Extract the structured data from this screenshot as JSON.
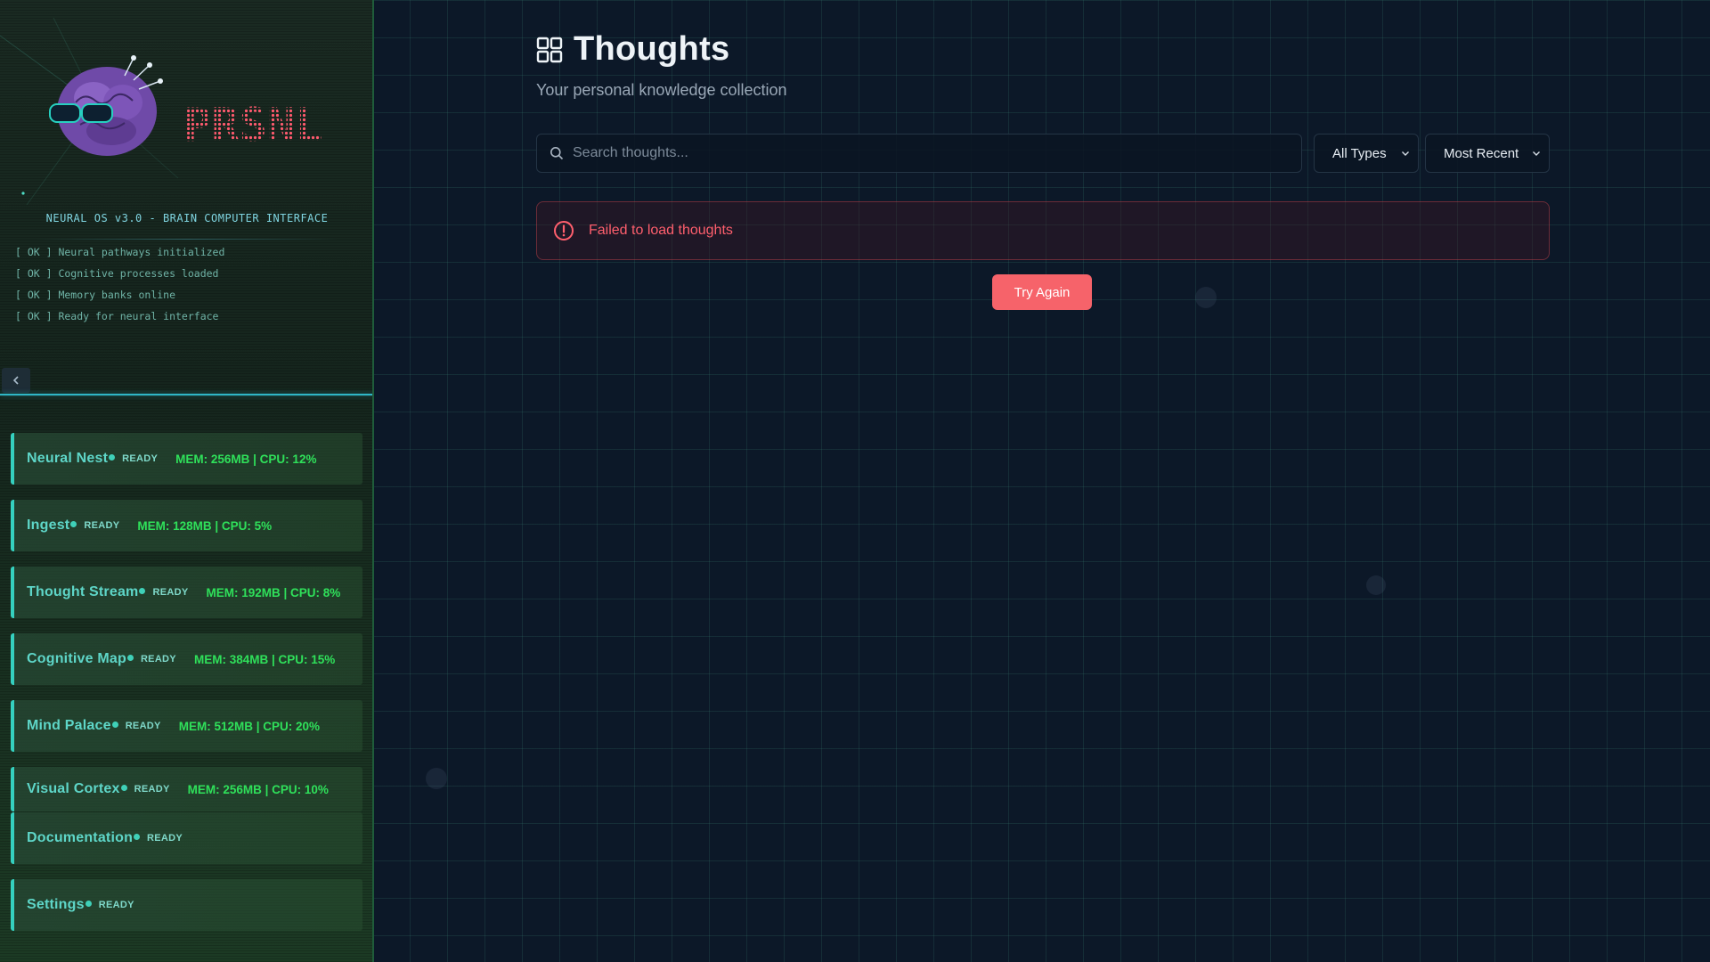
{
  "sidebar": {
    "brand": "PRSNL",
    "tagline": "NEURAL OS v3.0 - BRAIN COMPUTER INTERFACE",
    "boot_log": [
      "[ OK ] Neural pathways initialized",
      "[ OK ] Cognitive processes loaded",
      "[ OK ] Memory banks online",
      "[ OK ] Ready for neural interface"
    ],
    "collapse_icon": "chevron-left-icon",
    "nav_items": [
      {
        "label": "Neural Nest",
        "status": "READY",
        "stats": "MEM: 256MB | CPU: 12%"
      },
      {
        "label": "Ingest",
        "status": "READY",
        "stats": "MEM: 128MB | CPU: 5%"
      },
      {
        "label": "Thought Stream",
        "status": "READY",
        "stats": "MEM: 192MB | CPU: 8%"
      },
      {
        "label": "Cognitive Map",
        "status": "READY",
        "stats": "MEM: 384MB | CPU: 15%"
      },
      {
        "label": "Mind Palace",
        "status": "READY",
        "stats": "MEM: 512MB | CPU: 20%"
      },
      {
        "label": "Visual Cortex",
        "status": "READY",
        "stats": "MEM: 256MB | CPU: 10%"
      },
      {
        "label": "Documentation",
        "status": "READY",
        "stats": ""
      },
      {
        "label": "Settings",
        "status": "READY",
        "stats": ""
      }
    ]
  },
  "main": {
    "title": "Thoughts",
    "title_icon": "grid-icon",
    "subtitle": "Your personal knowledge collection",
    "search": {
      "placeholder": "Search thoughts...",
      "value": ""
    },
    "type_filter": {
      "selected": "All Types"
    },
    "sort_filter": {
      "selected": "Most Recent"
    },
    "error": {
      "message": "Failed to load thoughts",
      "icon": "alert-circle-icon"
    },
    "retry_label": "Try Again"
  },
  "colors": {
    "accent_teal": "#35d0bf",
    "stats_green": "#2fe05a",
    "error_red": "#ff5f6d",
    "button_red": "#f6636a",
    "background": "#0c1828"
  }
}
